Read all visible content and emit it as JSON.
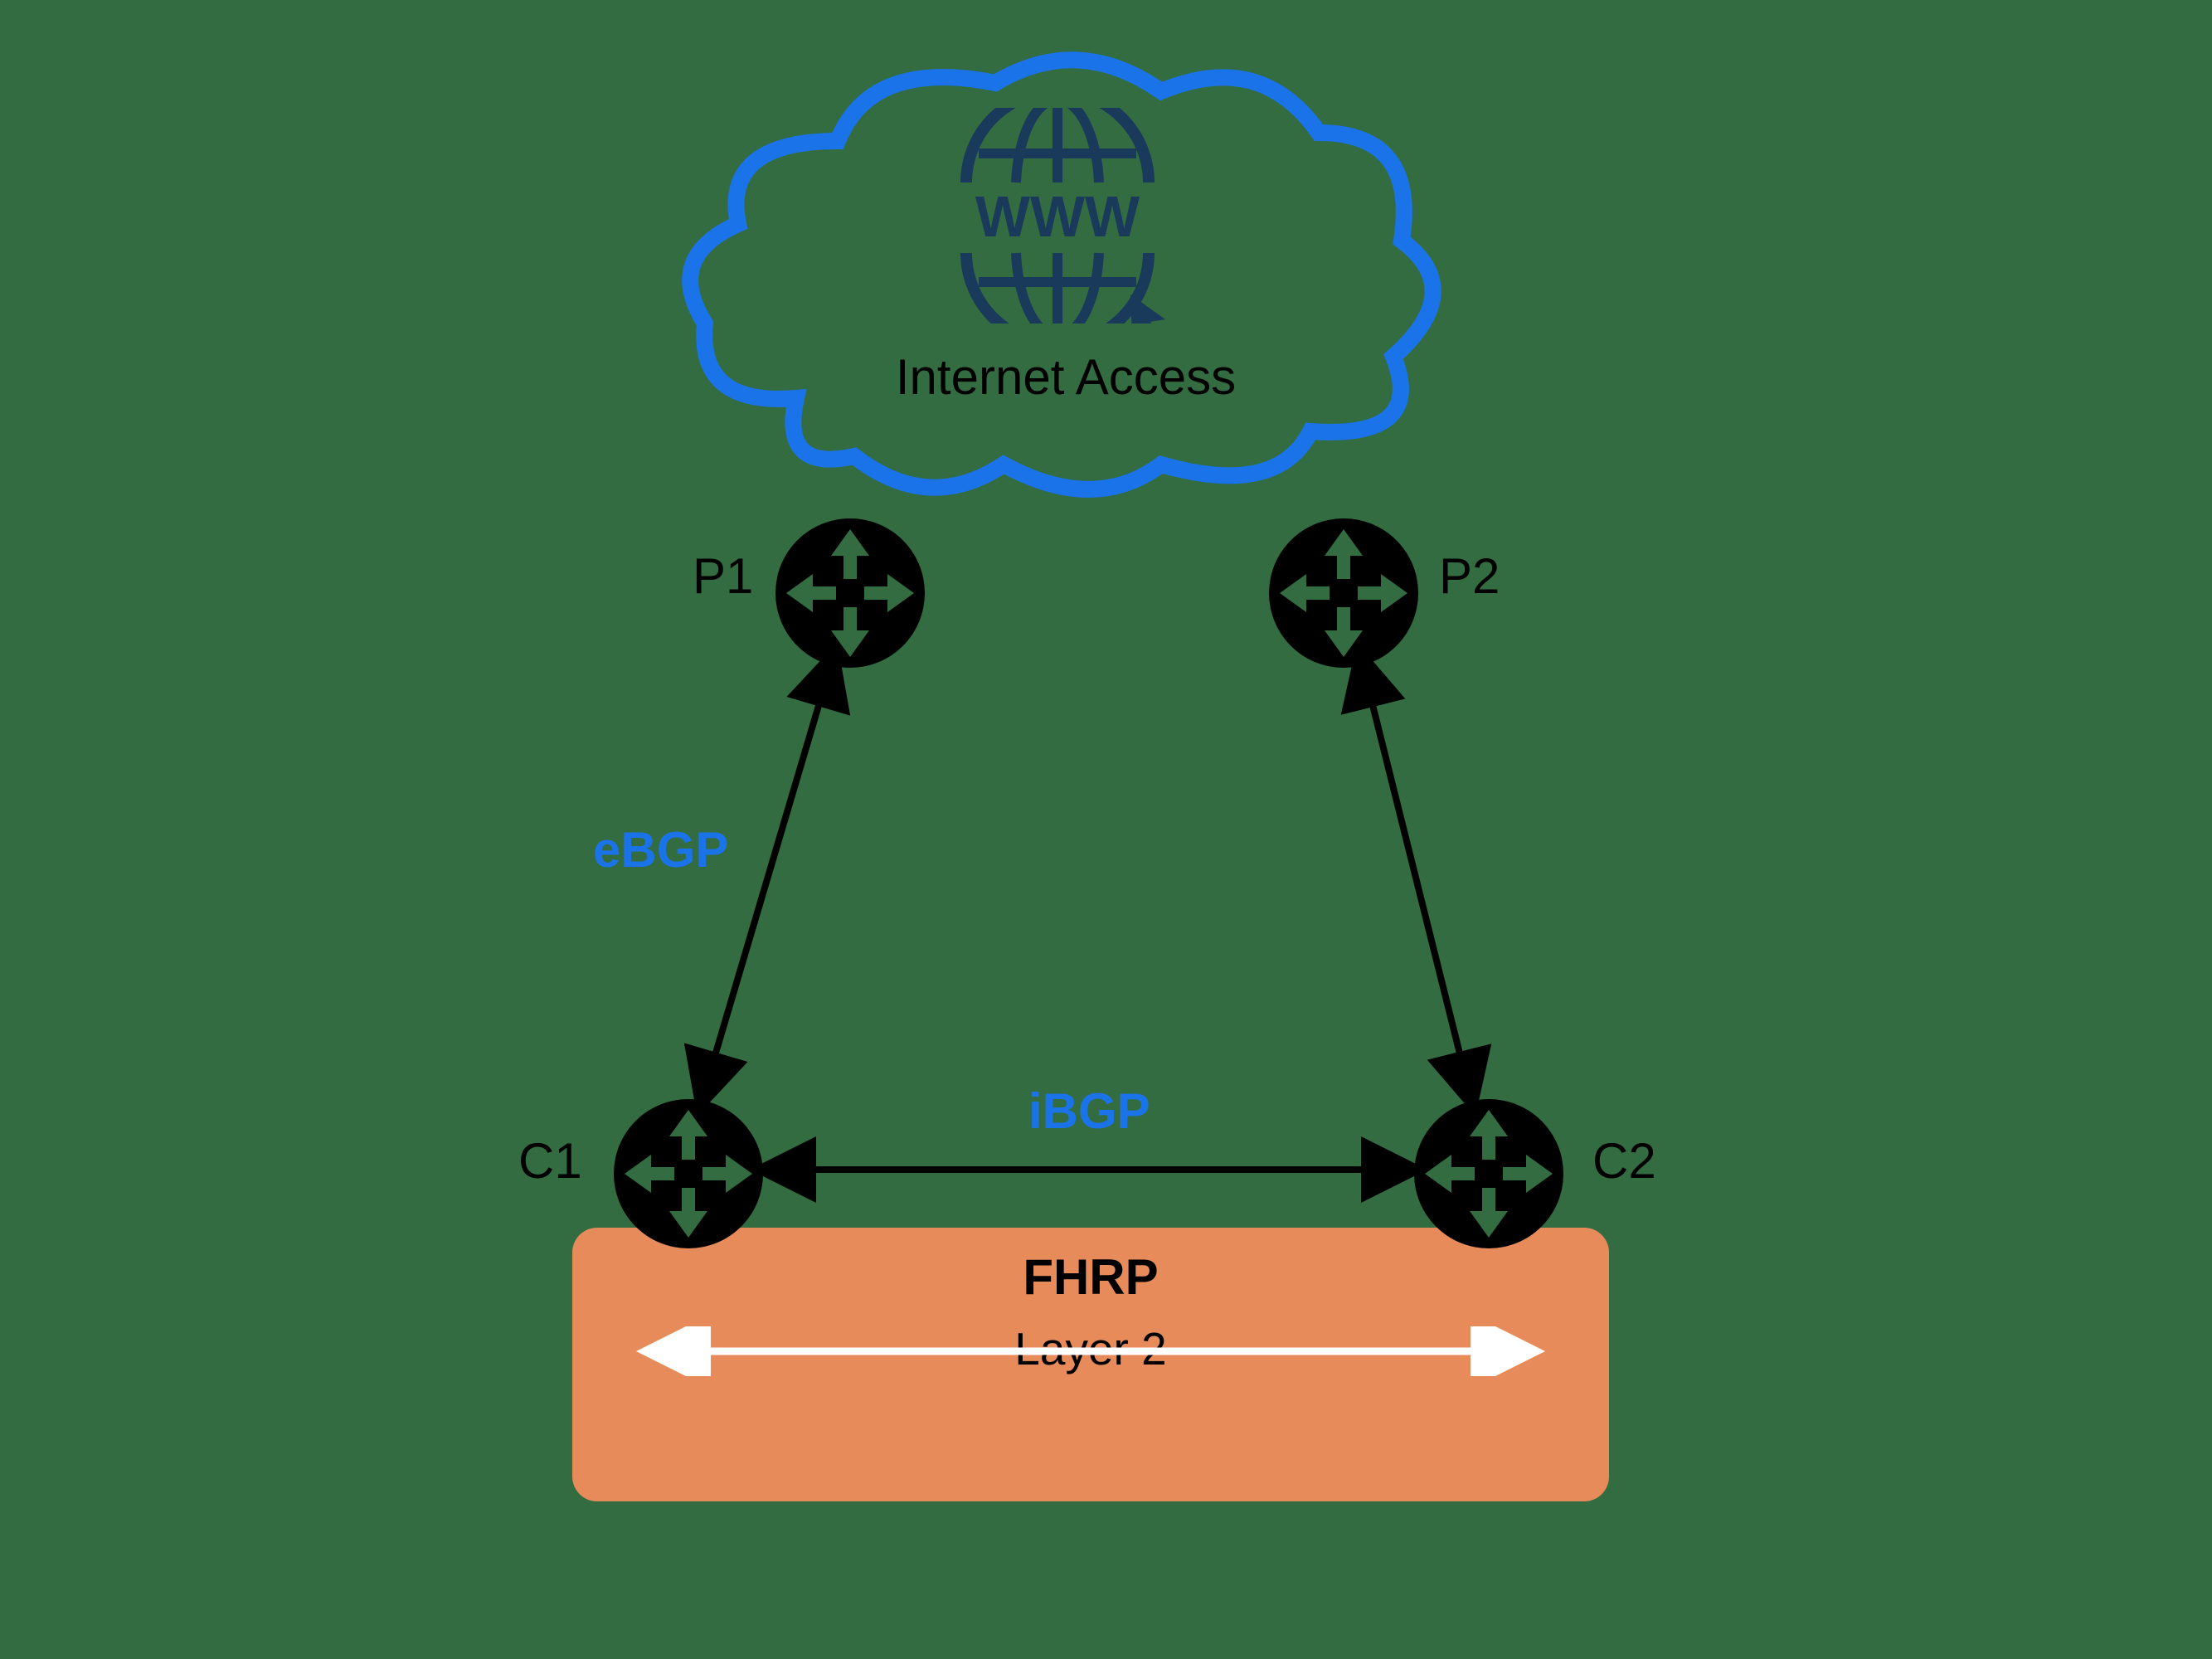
{
  "diagram": {
    "cloud": {
      "label": "Internet Access",
      "www_text": "WWW"
    },
    "routers": {
      "p1": {
        "label": "P1"
      },
      "p2": {
        "label": "P2"
      },
      "c1": {
        "label": "C1"
      },
      "c2": {
        "label": "C2"
      }
    },
    "links": {
      "ebgp": {
        "label": "eBGP"
      },
      "ibgp": {
        "label": "iBGP"
      }
    },
    "fhrp": {
      "title": "FHRP",
      "subtitle": "Layer 2"
    },
    "colors": {
      "background": "#346c42",
      "cloud_stroke": "#1a73e8",
      "router_fill": "#000000",
      "router_arrow": "#346c42",
      "protocol_text": "#1a73e8",
      "fhrp_bg": "#e88b5a",
      "www_text": "#193a5a",
      "link_line": "#000000",
      "fhrp_arrow": "#ffffff"
    }
  }
}
